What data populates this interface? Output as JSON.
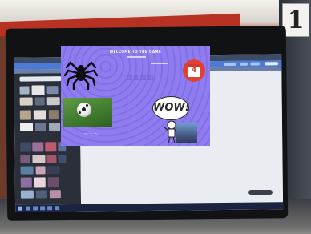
{
  "sign": {
    "number": "1"
  },
  "design": {
    "welcome": "WELCOME TO THE GAME",
    "bubble": "WOW!",
    "calendar_day": "4"
  }
}
